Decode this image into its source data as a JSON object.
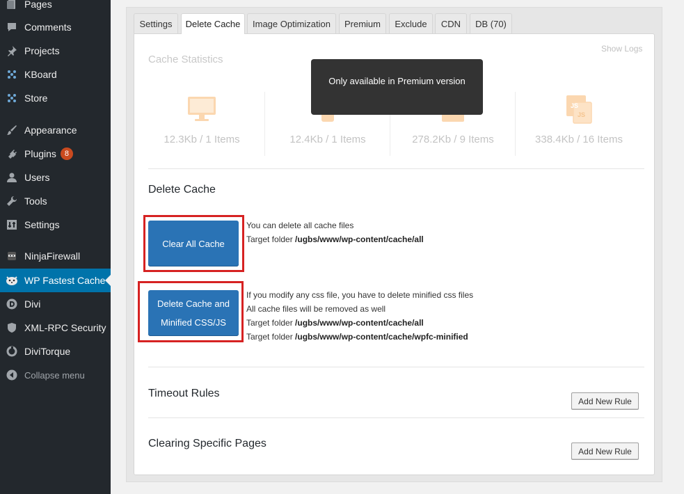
{
  "sidebar": {
    "items": [
      {
        "label": "Pages",
        "icon": "pages-icon",
        "badge": null
      },
      {
        "label": "Comments",
        "icon": "comments-icon",
        "badge": null
      },
      {
        "label": "Projects",
        "icon": "pin-icon",
        "badge": null
      },
      {
        "label": "KBoard",
        "icon": "dots-icon",
        "badge": null
      },
      {
        "label": "Store",
        "icon": "dots-icon",
        "badge": null
      },
      {
        "label": "Appearance",
        "icon": "brush-icon",
        "badge": null
      },
      {
        "label": "Plugins",
        "icon": "plug-icon",
        "badge": "8"
      },
      {
        "label": "Users",
        "icon": "user-icon",
        "badge": null
      },
      {
        "label": "Tools",
        "icon": "wrench-icon",
        "badge": null
      },
      {
        "label": "Settings",
        "icon": "settings-icon",
        "badge": null
      },
      {
        "label": "NinjaFirewall",
        "icon": "ninja-icon",
        "badge": null
      },
      {
        "label": "WP Fastest Cache",
        "icon": "cheetah-icon",
        "badge": null
      },
      {
        "label": "Divi",
        "icon": "divi-icon",
        "badge": null
      },
      {
        "label": "XML-RPC Security",
        "icon": "shield-icon",
        "badge": null
      },
      {
        "label": "DiviTorque",
        "icon": "divitorque-icon",
        "badge": null
      }
    ],
    "collapse_label": "Collapse menu",
    "active_item": "WP Fastest Cache"
  },
  "tabs": [
    {
      "label": "Settings"
    },
    {
      "label": "Delete Cache"
    },
    {
      "label": "Image Optimization"
    },
    {
      "label": "Premium"
    },
    {
      "label": "Exclude"
    },
    {
      "label": "CDN"
    },
    {
      "label": "DB (70)"
    }
  ],
  "active_tab": "Delete Cache",
  "stats": {
    "title": "Cache Statistics",
    "show_logs": "Show Logs",
    "tooltip": "Only available in Premium version",
    "items": [
      {
        "label": "12.3Kb / 1 Items",
        "icon": "monitor-icon"
      },
      {
        "label": "12.4Kb / 1 Items",
        "icon": "mobile-icon"
      },
      {
        "label": "278.2Kb / 9 Items",
        "icon": "css-icon"
      },
      {
        "label": "338.4Kb / 16 Items",
        "icon": "js-icon"
      }
    ]
  },
  "delete_cache": {
    "title": "Delete Cache",
    "clear_all_label": "Clear All Cache",
    "clear_all_desc_1": "You can delete all cache files",
    "target_folder_label": "Target folder",
    "clear_all_path": "/ugbs/www/wp-content/cache/all",
    "delete_minified_label_1": "Delete Cache and",
    "delete_minified_label_2": "Minified CSS/JS",
    "minified_desc_1": "If you modify any css file, you have to delete minified css files",
    "minified_desc_2": "All cache files will be removed as well",
    "minified_path_1": "/ugbs/www/wp-content/cache/all",
    "minified_path_2": "/ugbs/www/wp-content/cache/wpfc-minified"
  },
  "timeout_rules": {
    "title": "Timeout Rules",
    "button": "Add New Rule"
  },
  "clearing_pages": {
    "title": "Clearing Specific Pages",
    "button": "Add New Rule"
  },
  "colors": {
    "accent": "#0073aa",
    "button_blue": "#2a73b5",
    "highlight_red": "#d62222",
    "stat_orange": "#fbd7b0"
  }
}
